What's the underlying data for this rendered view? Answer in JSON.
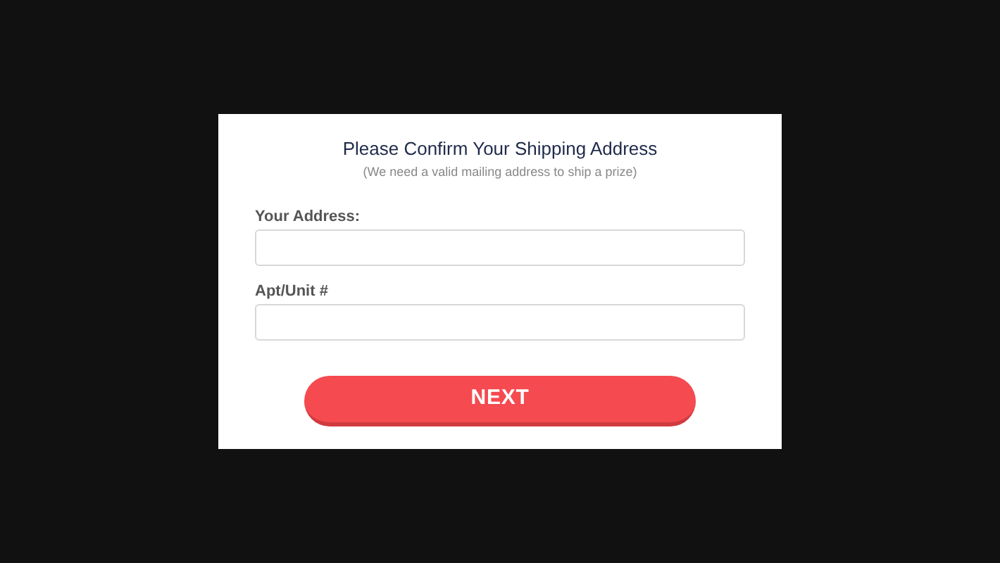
{
  "dialog": {
    "title": "Please Confirm Your Shipping Address",
    "subtitle": "(We need a valid mailing address to ship a prize)",
    "fields": [
      {
        "label": "Your Address:"
      },
      {
        "label": "Apt/Unit #"
      }
    ],
    "button": "NEXT"
  }
}
